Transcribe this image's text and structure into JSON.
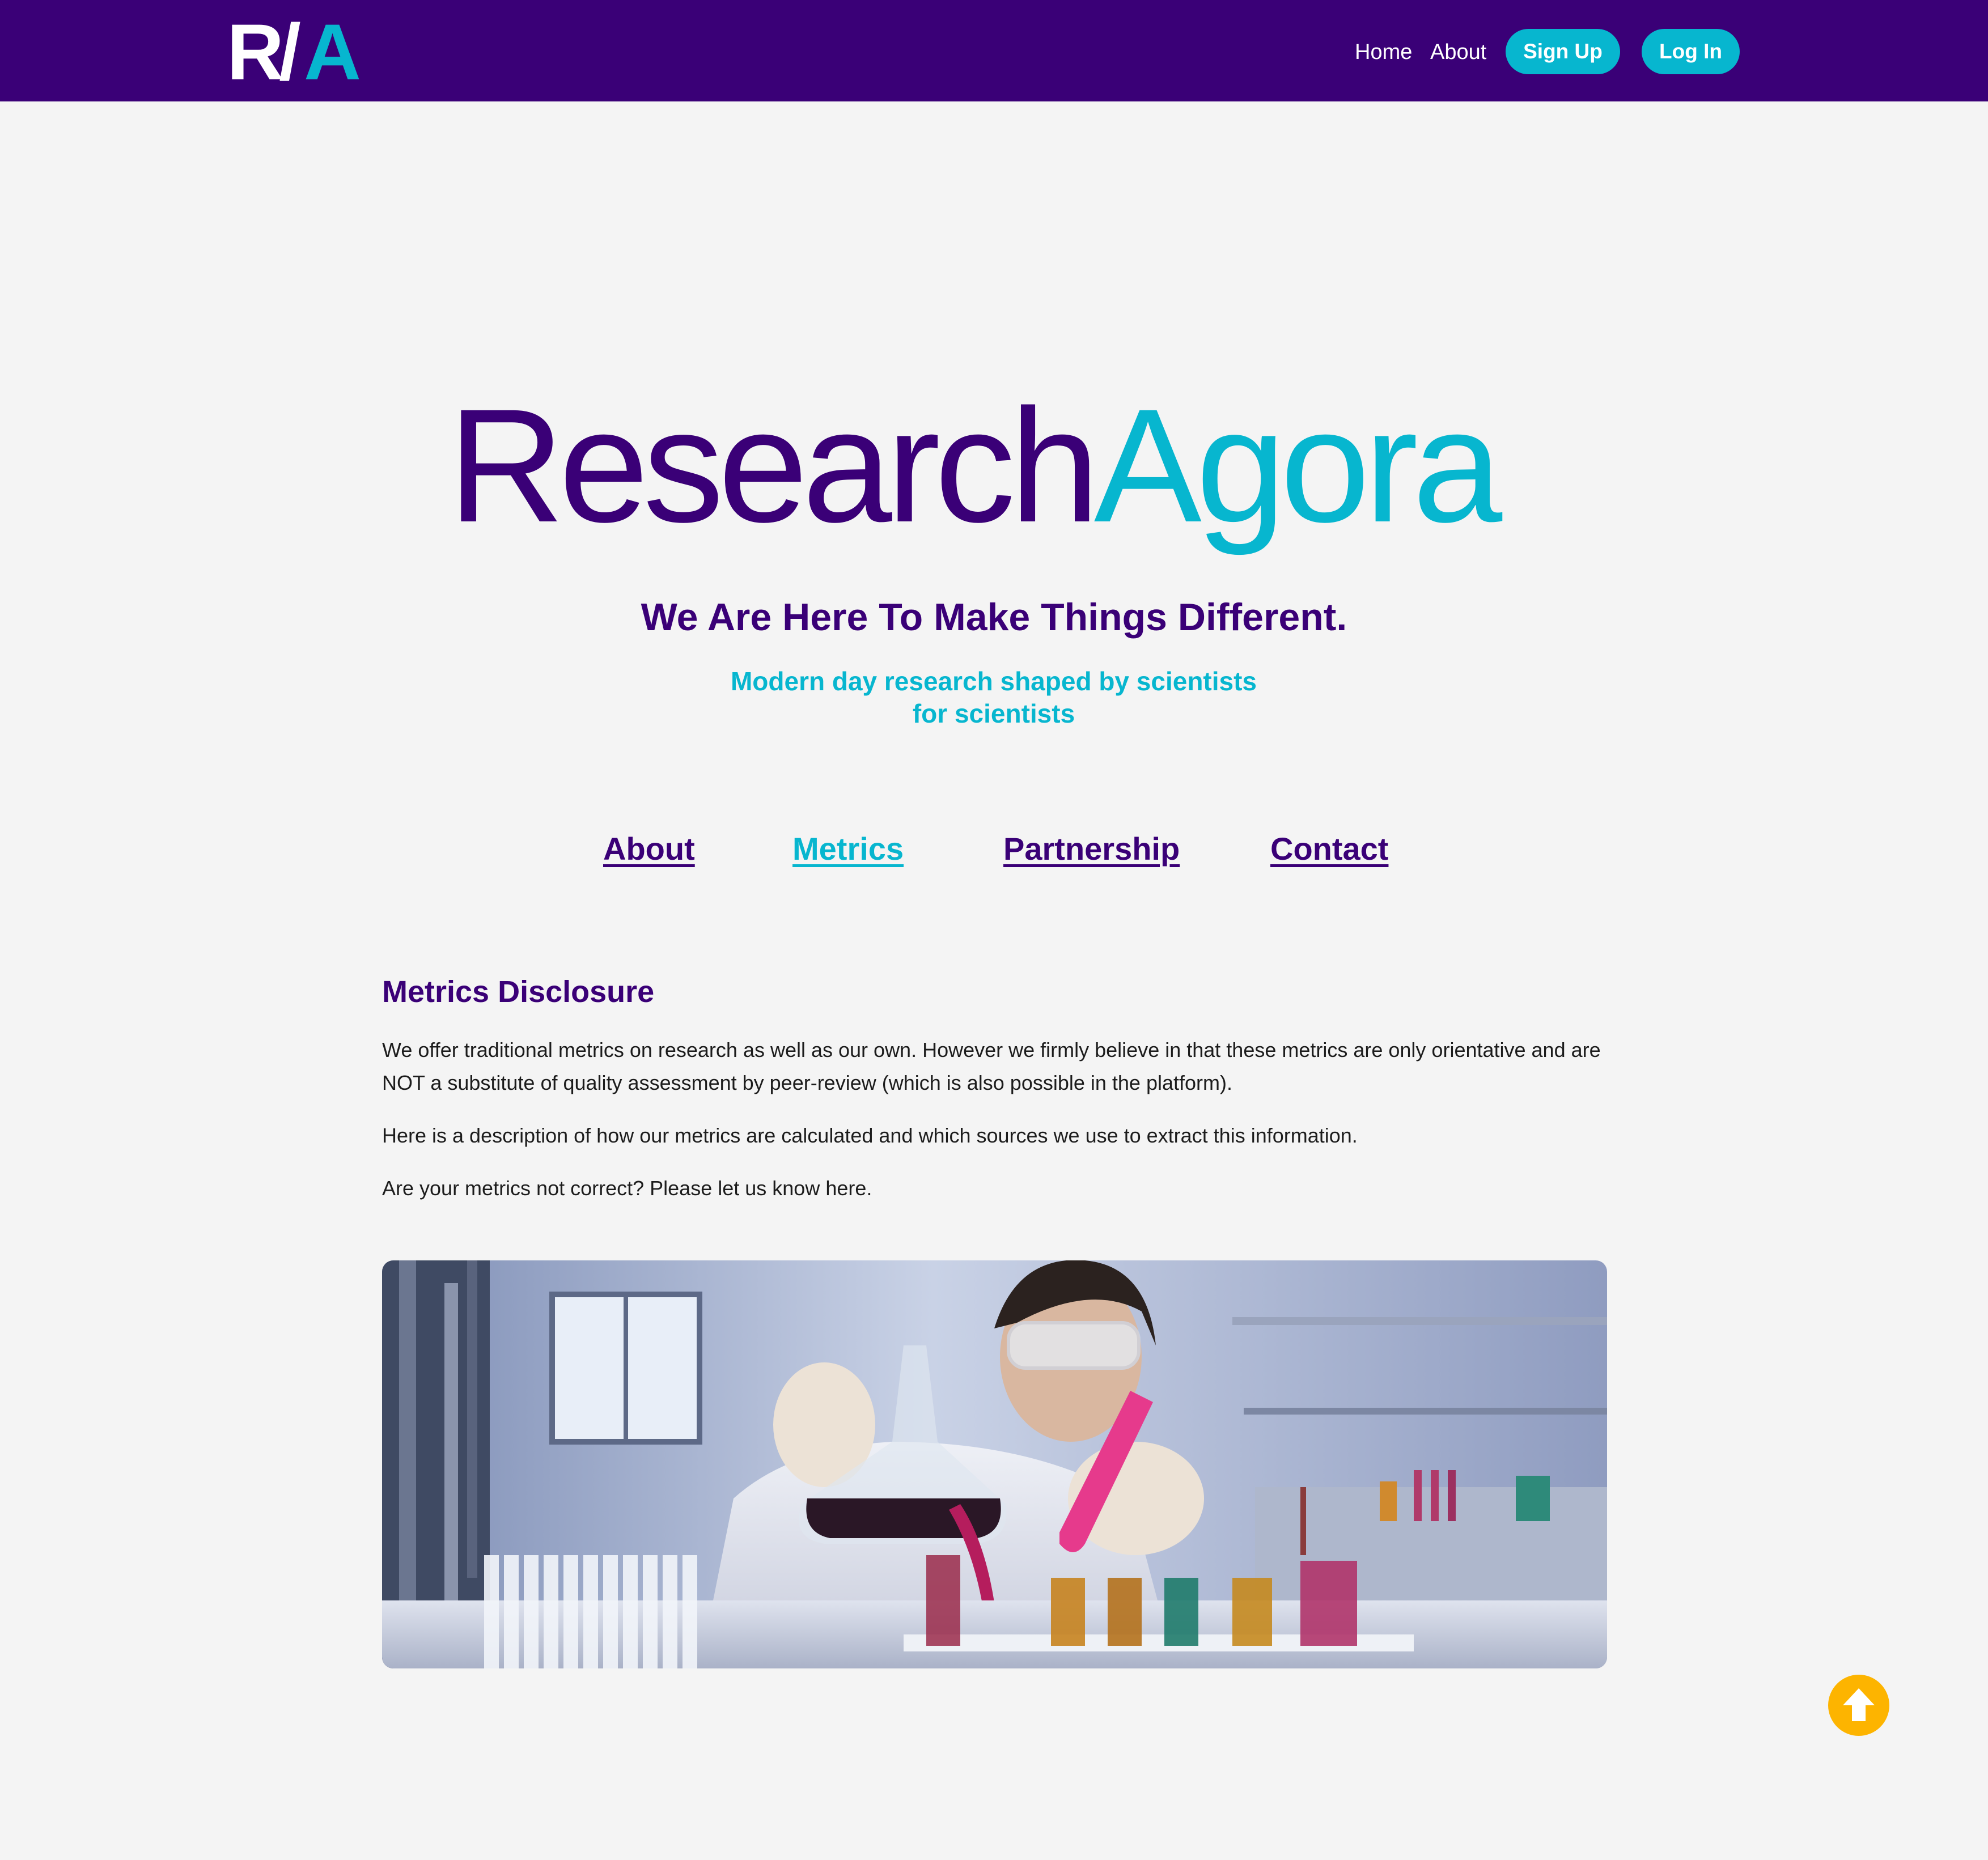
{
  "header": {
    "logo_alt": "R/A",
    "nav": {
      "home": "Home",
      "about": "About",
      "sign_up": "Sign Up",
      "log_in": "Log In"
    }
  },
  "hero": {
    "wordmark_part1": "Research",
    "wordmark_part2": "Agora",
    "tagline": "We Are Here To Make Things Different.",
    "subtagline": "Modern day research shaped by scientists for scientists"
  },
  "sections": {
    "about": "About",
    "metrics": "Metrics",
    "partnership": "Partnership",
    "contact": "Contact",
    "active": "Metrics"
  },
  "metrics": {
    "title": "Metrics Disclosure",
    "paragraph1": "We offer traditional metrics on research as well as our own. However we firmly believe in that these metrics are only orientative and are NOT a substitute of quality assessment by peer-review (which is also possible in the platform).",
    "paragraph2": "Here is a description of how our metrics are calculated and which sources we use to extract this information.",
    "paragraph3": "Are your metrics not correct? Please let us know here."
  },
  "icons": {
    "scroll_top": "arrow-up-circle-icon"
  },
  "colors": {
    "primary_purple": "#3a0077",
    "accent_cyan": "#07b6cf",
    "scroll_button": "#fdb400",
    "background": "#f4f4f4"
  }
}
